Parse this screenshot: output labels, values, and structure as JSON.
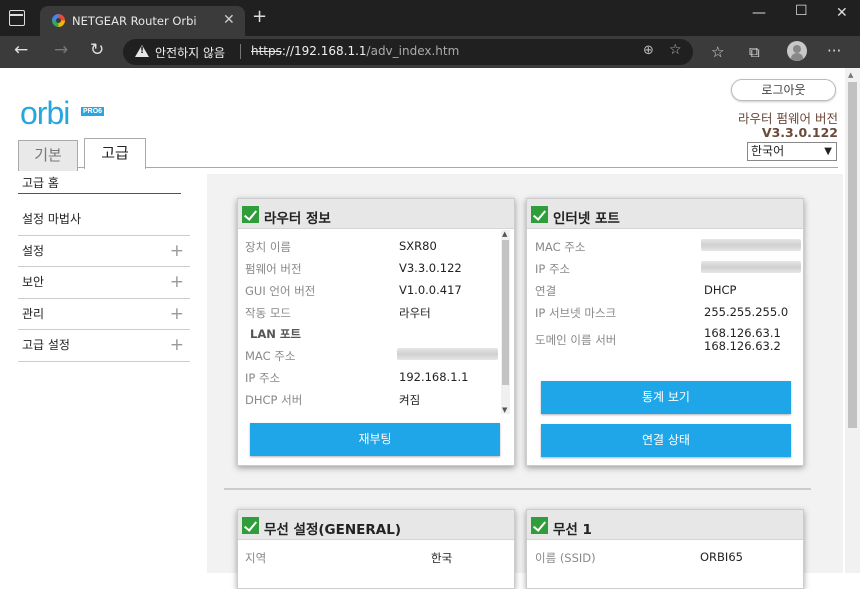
{
  "browser": {
    "tab_title": "NETGEAR Router Orbi",
    "security_label": "안전하지 않음",
    "url_scheme": "https",
    "url_host": "://192.168.1.1",
    "url_path": "/adv_index.htm"
  },
  "header": {
    "logo_text": "orbi",
    "logo_badge": "PRO6",
    "logout_label": "로그아웃",
    "firmware_label": "라우터 펌웨어 버전",
    "firmware_version": "V3.3.0.122",
    "language_selected": "한국어"
  },
  "main_tabs": {
    "basic": "기본",
    "advanced": "고급"
  },
  "sidebar": {
    "items": [
      {
        "label": "고급 홈"
      },
      {
        "label": "설정 마법사"
      },
      {
        "label": "설정"
      },
      {
        "label": "보안"
      },
      {
        "label": "관리"
      },
      {
        "label": "고급 설정"
      }
    ]
  },
  "router_info": {
    "title": "라우터 정보",
    "rows": [
      {
        "label": "장치 이름",
        "value": "SXR80"
      },
      {
        "label": "펌웨어 버전",
        "value": "V3.3.0.122"
      },
      {
        "label": "GUI 언어 버전",
        "value": "V1.0.0.417"
      },
      {
        "label": "작동 모드",
        "value": "라우터"
      }
    ],
    "lan_heading": "LAN 포트",
    "lan_rows": [
      {
        "label": "MAC 주소",
        "value": ""
      },
      {
        "label": "IP 주소",
        "value": "192.168.1.1"
      },
      {
        "label": "DHCP 서버",
        "value": "켜짐"
      }
    ],
    "button": "재부팅"
  },
  "internet_port": {
    "title": "인터넷 포트",
    "rows": [
      {
        "label": "MAC 주소",
        "value": ""
      },
      {
        "label": "IP 주소",
        "value": ""
      },
      {
        "label": "연결",
        "value": "DHCP"
      },
      {
        "label": "IP 서브넷 마스크",
        "value": "255.255.255.0"
      },
      {
        "label": "도메인 이름 서버",
        "value": "168.126.63.1",
        "value2": "168.126.63.2"
      }
    ],
    "button_stats": "통계 보기",
    "button_status": "연결 상태"
  },
  "wireless_general": {
    "title": "무선 설정(GENERAL)",
    "rows": [
      {
        "label": "지역",
        "value": "한국"
      }
    ]
  },
  "wireless1": {
    "title": "무선 1",
    "rows": [
      {
        "label": "이름 (SSID)",
        "value": "ORBI65"
      }
    ]
  },
  "colors": {
    "accent": "#1ea6e8",
    "check": "#2f9e3a",
    "logo": "#2aa6df"
  }
}
